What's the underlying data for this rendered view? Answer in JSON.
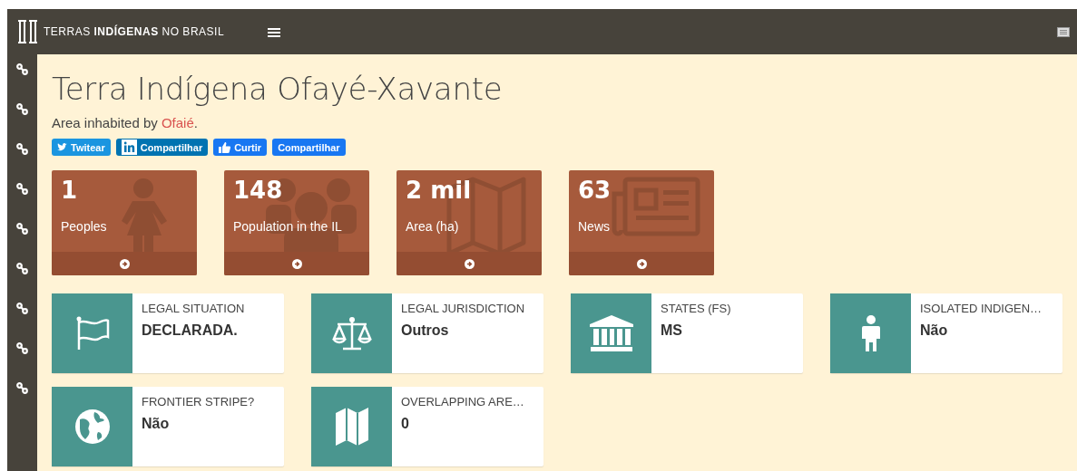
{
  "navbar": {
    "logo_text": "TERRAS **INDÍGENAS** NO BRASIL"
  },
  "sidebar_items": [
    {
      "kind": "link"
    },
    {
      "kind": "link"
    },
    {
      "kind": "link"
    },
    {
      "kind": "link"
    },
    {
      "kind": "link"
    },
    {
      "kind": "link"
    },
    {
      "kind": "link"
    },
    {
      "kind": "link"
    },
    {
      "kind": "link"
    }
  ],
  "title": "Terra Indígena Ofayé-Xavante",
  "subtitle": {
    "text": "Area inhabited by ",
    "link": "Ofaié",
    "end": "."
  },
  "share_buttons": [
    {
      "kind": "twitter",
      "label": "Twitear"
    },
    {
      "kind": "linkedin",
      "label": "Compartilhar"
    },
    {
      "kind": "like",
      "label": "Curtir"
    },
    {
      "kind": "plain",
      "label": "Compartilhar"
    }
  ],
  "stats": [
    {
      "kind": "person",
      "value": "1",
      "label": "Peoples"
    },
    {
      "kind": "group",
      "value": "148",
      "label": "Population in the IL"
    },
    {
      "kind": "map",
      "value": "2 mil",
      "label": "Area (ha)"
    },
    {
      "kind": "news",
      "value": "63",
      "label": "News"
    }
  ],
  "info_cards": [
    {
      "kind": "flag",
      "title": "LEGAL SITUATION",
      "value": "DECLARADA."
    },
    {
      "kind": "scale",
      "title": "LEGAL JURISDICTION",
      "value": "Outros"
    },
    {
      "kind": "bank",
      "title": "STATES (FS)",
      "value": "MS"
    },
    {
      "kind": "person",
      "title": "ISOLATED INDIGEN…",
      "value": "Não"
    },
    {
      "kind": "globe",
      "title": "FRONTIER STRIPE?",
      "value": "Não"
    },
    {
      "kind": "map",
      "title": "OVERLAPPING ARE…",
      "value": "0"
    }
  ]
}
